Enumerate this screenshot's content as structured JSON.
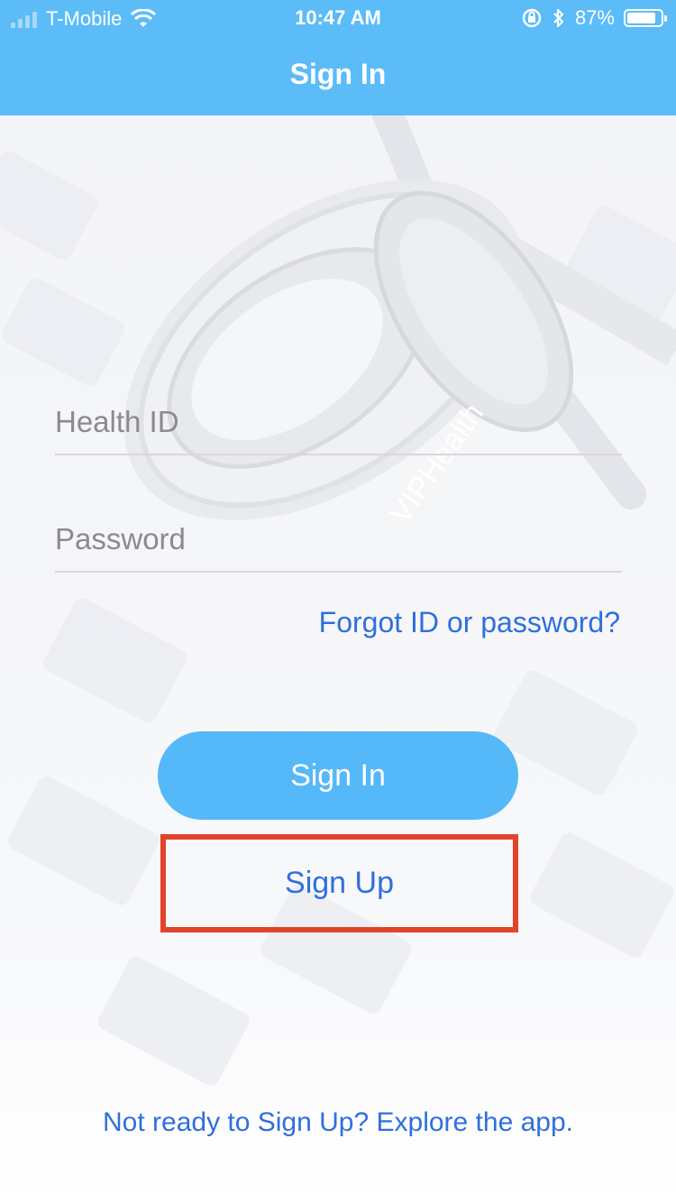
{
  "status_bar": {
    "carrier": "T-Mobile",
    "time": "10:47 AM",
    "battery_percent": "87%",
    "battery_level": 0.87,
    "icons": [
      "signal-icon",
      "wifi-icon",
      "orientation-lock-icon",
      "bluetooth-icon",
      "battery-icon"
    ]
  },
  "nav": {
    "title": "Sign In"
  },
  "background": {
    "watermark_text": "VIPHealth"
  },
  "form": {
    "health_id_placeholder": "Health ID",
    "health_id_value": "",
    "password_placeholder": "Password",
    "password_value": "",
    "forgot_link": "Forgot ID or password?"
  },
  "actions": {
    "sign_in_label": "Sign In",
    "sign_up_label": "Sign Up",
    "explore_link": "Not ready to Sign Up? Explore the app."
  },
  "colors": {
    "brand_blue": "#5bbcf7",
    "button_blue": "#55b8f9",
    "link_blue": "#2f6fde",
    "highlight_red": "#e3432b"
  }
}
